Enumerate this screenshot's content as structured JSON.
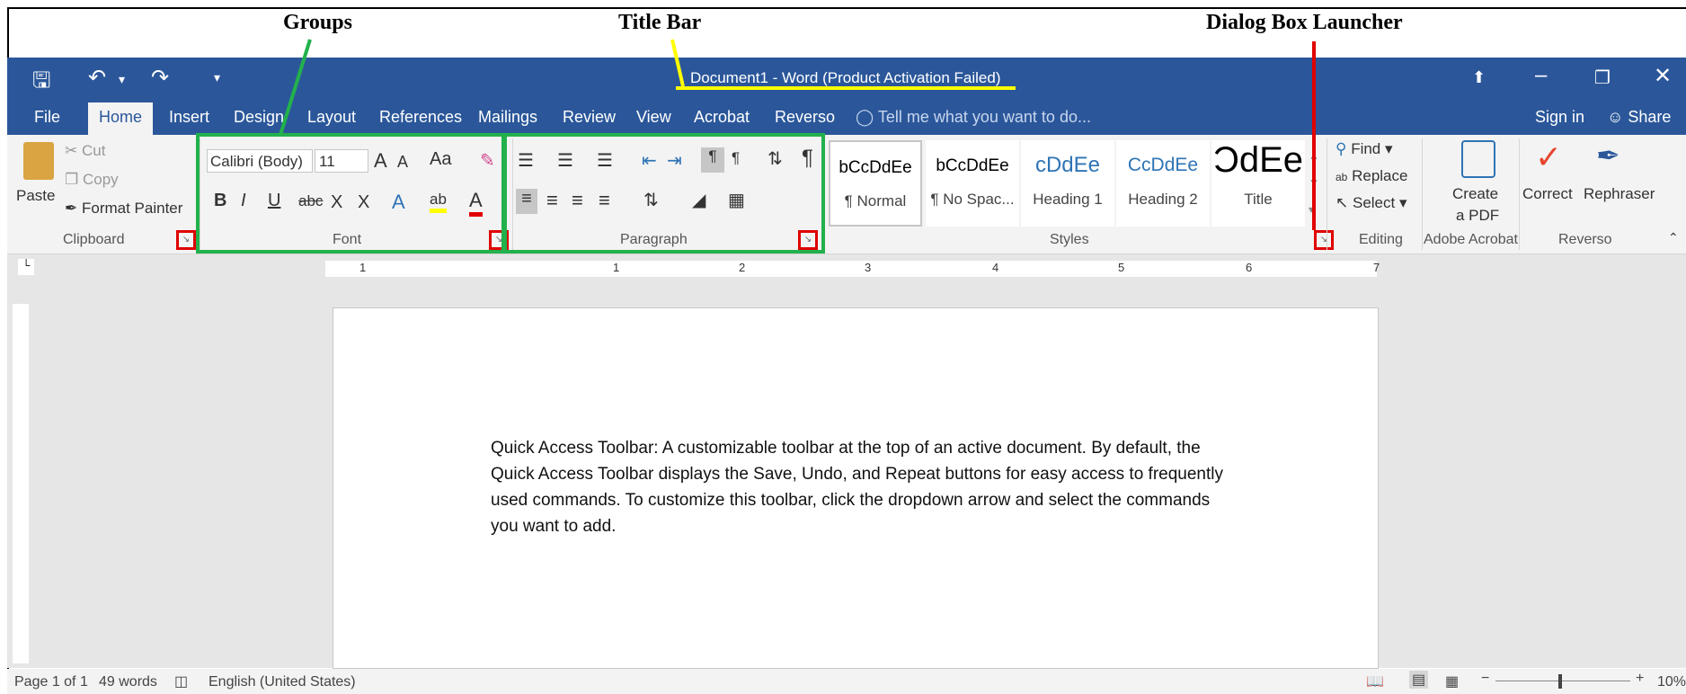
{
  "callouts": {
    "groups": "Groups",
    "title_bar": "Title Bar",
    "dialog_box_launcher": "Dialog Box Launcher"
  },
  "title": "Document1 - Word (Product Activation Failed)",
  "tabs": [
    "File",
    "Home",
    "Insert",
    "Design",
    "Layout",
    "References",
    "Mailings",
    "Review",
    "View",
    "Acrobat",
    "Reverso"
  ],
  "tell_me": "Tell me what you want to do...",
  "sign_in": "Sign in",
  "share": "Share",
  "clipboard": {
    "paste": "Paste",
    "cut": "Cut",
    "copy": "Copy",
    "format_painter": "Format Painter",
    "label": "Clipboard"
  },
  "font": {
    "name": "Calibri (Body)",
    "size": "11",
    "change_case": "Aa",
    "label": "Font"
  },
  "paragraph": {
    "label": "Paragraph"
  },
  "styles": {
    "items": [
      {
        "preview": "bCcDdEe",
        "name": "¶ Normal"
      },
      {
        "preview": "bCcDdEe",
        "name": "¶ No Spac..."
      },
      {
        "preview": "cDdEe",
        "name": "Heading 1"
      },
      {
        "preview": "CcDdEe",
        "name": "Heading 2"
      },
      {
        "preview": "ƆdEe",
        "name": "Title"
      }
    ],
    "label": "Styles"
  },
  "editing": {
    "find": "Find",
    "replace": "Replace",
    "select": "Select",
    "label": "Editing"
  },
  "acrobat": {
    "create": "Create",
    "a_pdf": "a PDF",
    "label": "Adobe Acrobat"
  },
  "reverso": {
    "correct": "Correct",
    "rephraser": "Rephraser",
    "label": "Reverso"
  },
  "ruler_numbers": [
    "1",
    "1",
    "2",
    "3",
    "4",
    "5",
    "6",
    "7"
  ],
  "document_text": "Quick Access Toolbar: A customizable toolbar at the top of an active document. By default, the Quick Access Toolbar displays the Save, Undo, and Repeat buttons for easy access to frequently used commands. To customize this toolbar, click the dropdown arrow and select the commands you want to add.",
  "status": {
    "page": "Page 1 of 1",
    "words": "49 words",
    "language": "English (United States)",
    "zoom": "10%"
  },
  "colors": {
    "word_blue": "#2b579a",
    "groups_outline": "#22b14c",
    "title_outline": "#ffff00",
    "launcher_outline": "#e00000"
  }
}
